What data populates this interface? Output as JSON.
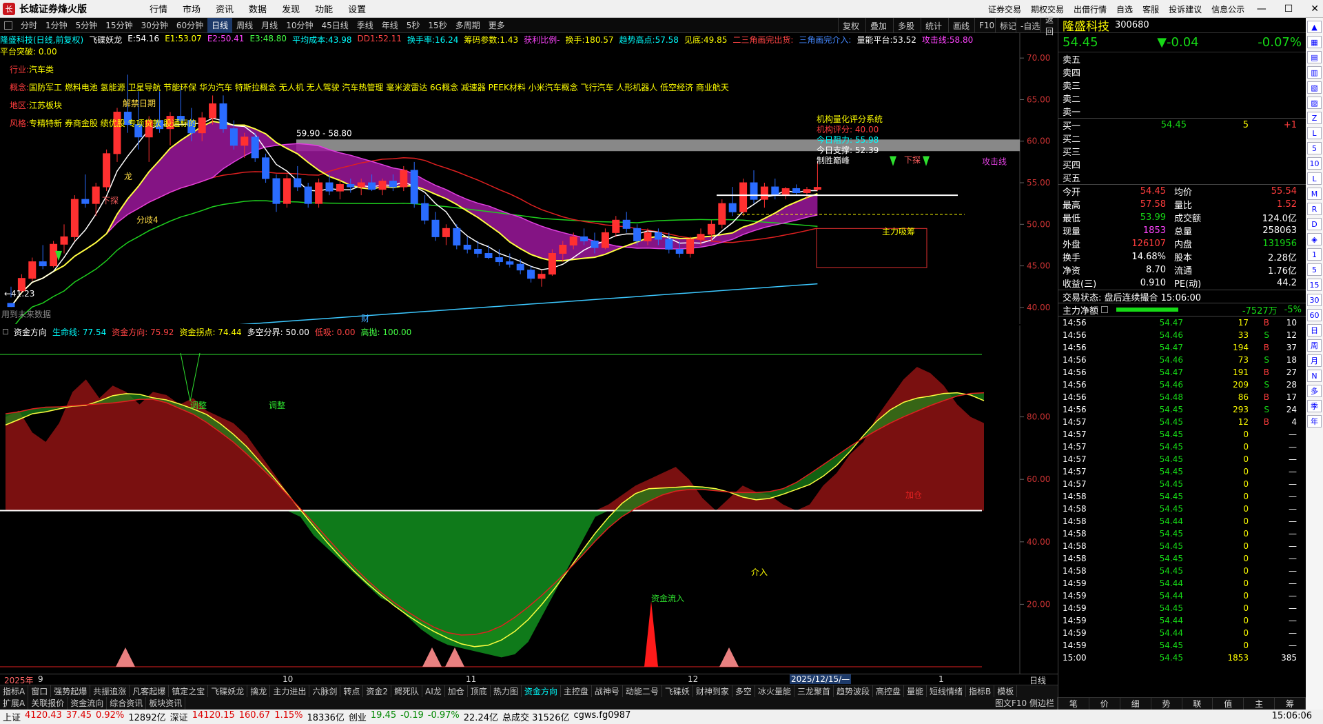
{
  "app": {
    "title": "长城证券烽火版"
  },
  "menu": [
    "行情",
    "市场",
    "资讯",
    "数据",
    "发现",
    "功能",
    "设置"
  ],
  "top_right_menu": [
    "证券交易",
    "期权交易",
    "出借行情",
    "自选",
    "客服",
    "投诉建议",
    "信息公示"
  ],
  "periods": [
    "分时",
    "1分钟",
    "5分钟",
    "15分钟",
    "30分钟",
    "60分钟",
    "日线",
    "周线",
    "月线",
    "10分钟",
    "45日线",
    "季线",
    "年线",
    "5秒",
    "15秒",
    "多周期",
    "更多"
  ],
  "active_period": "日线",
  "toolbar_right": [
    "复权",
    "叠加",
    "多股",
    "统计",
    "画线",
    "F10",
    "标记",
    "-自选",
    "返回"
  ],
  "main_header": {
    "stock": "隆盛科技(日线,前复权)",
    "indicator": "飞碟妖龙",
    "items": [
      {
        "t": "E:54.16",
        "c": "#ffffff"
      },
      {
        "t": "E1:53.07",
        "c": "#ffff00"
      },
      {
        "t": "E2:50.41",
        "c": "#ff44ff"
      },
      {
        "t": "E3:48.80",
        "c": "#44ff44"
      },
      {
        "t": "平均成本:43.98",
        "c": "#00ffff"
      },
      {
        "t": "DD1:52.11",
        "c": "#ff4444"
      },
      {
        "t": "换手率:16.24",
        "c": "#00ffff"
      },
      {
        "t": "筹码参数:1.43",
        "c": "#ffff00"
      },
      {
        "t": "获利比例-",
        "c": "#ff44ff"
      },
      {
        "t": "换手:180.57",
        "c": "#ffff00"
      },
      {
        "t": "趋势高点:57.58",
        "c": "#00ffff"
      },
      {
        "t": "见底:49.85",
        "c": "#ffff00"
      },
      {
        "t": "二三角画完出货:",
        "c": "#ff4444"
      },
      {
        "t": "三角画完介入:",
        "c": "#4488ff"
      },
      {
        "t": "量能平台:53.52",
        "c": "#ffffff"
      },
      {
        "t": "攻击线:58.80",
        "c": "#ff44ff"
      }
    ],
    "platform": "平台突破: 0.00"
  },
  "stock_info": {
    "industry_label": "行业:",
    "industry": "汽车类",
    "concept_label": "概念:",
    "concept": "国防军工 燃料电池 氢能源 卫星导航 节能环保 华为汽车 特斯拉概念 无人机 无人驾驶 汽车热管理 毫米波雷达 6G概念 减速器 PEEK材料 小米汽车概念 飞行汽车 人形机器人 低空经济 商业航天",
    "region_label": "地区:",
    "region": "江苏板块",
    "style_label": "风格:",
    "style": "专精特新 券商金股 绩优股 专项贷款 股通标的"
  },
  "quant_box": {
    "title": "机构量化评分系统",
    "score": "机构评分: 40.00",
    "resist": "今日阻力: 55.98",
    "support": "今日支撑: 52.39",
    "verdict": "制胜巅峰"
  },
  "chart_labels": {
    "range_label": "59.90 - 58.80",
    "low_label": "←41.23",
    "future": "用到未来数据",
    "attack_line": "攻击线",
    "cai": "财",
    "jiejin": "解禁日期",
    "fenyi4": "分歧4",
    "xiatan": "下探",
    "zhuli": "主力吸筹",
    "long": "龙"
  },
  "main_axis": [
    "70.00",
    "65.00",
    "60.00",
    "55.00",
    "50.00",
    "45.00",
    "40.00"
  ],
  "sub_header": {
    "name": "资金方向",
    "items": [
      {
        "t": "生命线: 77.54",
        "c": "#00ffff"
      },
      {
        "t": "资金方向: 75.92",
        "c": "#ff4444"
      },
      {
        "t": "资金拐点: 74.44",
        "c": "#ffff00"
      },
      {
        "t": "多空分界: 50.00",
        "c": "#ffffff"
      },
      {
        "t": "低吸: 0.00",
        "c": "#ff4444"
      },
      {
        "t": "高抛: 100.00",
        "c": "#44ff44"
      }
    ]
  },
  "sub_axis": [
    "80.00",
    "60.00",
    "40.00",
    "20.00"
  ],
  "sub_labels": {
    "tz1": "调整",
    "tz2": "调整",
    "inflow": "资金流入",
    "jieru": "介入",
    "jiaru": "加仓"
  },
  "time_axis": [
    "2025年",
    "9",
    "10",
    "11",
    "12",
    "2025/12/15/—",
    "1"
  ],
  "time_right": "日线",
  "tabs1": [
    "指标A",
    "窗口",
    "强势起爆",
    "共振追涨",
    "凡客起爆",
    "镇定之宝",
    "飞碟妖龙",
    "擒龙",
    "主力进出",
    "六脉剑",
    "转点",
    "资金2",
    "鳄死队",
    "AI龙",
    "加仓",
    "顶底",
    "热力图",
    "资金方向",
    "主控盘",
    "战神号",
    "动能二号",
    "飞碟妖",
    "财神到家",
    "多空",
    "冰火量能",
    "三龙聚首",
    "趋势波段",
    "高控盘",
    "量能",
    "短线情绪",
    "指标B",
    "模板"
  ],
  "tabs1_active": "资金方向",
  "tabs2": [
    "扩展A",
    "关联报价",
    "资金流向",
    "综合资讯",
    "板块资讯"
  ],
  "tabs2_right": "图文F10 侧边栏",
  "quote": {
    "name": "隆盛科技",
    "code": "300680",
    "price": "54.45",
    "change": "▼-0.04",
    "pct": "-0.07%",
    "asks": [
      "卖五",
      "卖四",
      "卖三",
      "卖二",
      "卖一"
    ],
    "bids": [
      {
        "l": "买一",
        "p": "54.45",
        "v": "5",
        "c": "+1"
      },
      {
        "l": "买二",
        "p": "",
        "v": "",
        "c": ""
      },
      {
        "l": "买三",
        "p": "",
        "v": "",
        "c": ""
      },
      {
        "l": "买四",
        "p": "",
        "v": "",
        "c": ""
      },
      {
        "l": "买五",
        "p": "",
        "v": "",
        "c": ""
      }
    ],
    "stats": [
      [
        "今开",
        "54.45",
        "均价",
        "55.54"
      ],
      [
        "最高",
        "57.58",
        "量比",
        "1.52"
      ],
      [
        "最低",
        "53.99",
        "成交额",
        "124.0亿"
      ],
      [
        "现量",
        "1853",
        "总量",
        "258063"
      ],
      [
        "外盘",
        "126107",
        "内盘",
        "131956"
      ],
      [
        "换手",
        "14.68%",
        "股本",
        "2.28亿"
      ],
      [
        "净资",
        "8.70",
        "流通",
        "1.76亿"
      ],
      [
        "收益(三)",
        "0.910",
        "PE(动)",
        "44.2"
      ]
    ],
    "trade_state": "交易状态: 盘后连续撮合 15:06:00",
    "main_net_label": "主力净额",
    "main_net": "-7527万",
    "main_net_pct": "-5%"
  },
  "ticks": [
    [
      "14:56",
      "54.47",
      "17",
      "B",
      "10"
    ],
    [
      "14:56",
      "54.46",
      "33",
      "S",
      "12"
    ],
    [
      "14:56",
      "54.47",
      "194",
      "B",
      "37"
    ],
    [
      "14:56",
      "54.46",
      "73",
      "S",
      "18"
    ],
    [
      "14:56",
      "54.47",
      "191",
      "B",
      "27"
    ],
    [
      "14:56",
      "54.46",
      "209",
      "S",
      "28"
    ],
    [
      "14:56",
      "54.48",
      "86",
      "B",
      "17"
    ],
    [
      "14:56",
      "54.45",
      "293",
      "S",
      "24"
    ],
    [
      "14:57",
      "54.45",
      "12",
      "B",
      "4"
    ],
    [
      "14:57",
      "54.45",
      "0",
      "",
      ""
    ],
    [
      "14:57",
      "54.45",
      "0",
      "",
      ""
    ],
    [
      "14:57",
      "54.45",
      "0",
      "",
      ""
    ],
    [
      "14:57",
      "54.45",
      "0",
      "",
      ""
    ],
    [
      "14:57",
      "54.45",
      "0",
      "",
      ""
    ],
    [
      "14:58",
      "54.45",
      "0",
      "",
      ""
    ],
    [
      "14:58",
      "54.45",
      "0",
      "",
      ""
    ],
    [
      "14:58",
      "54.44",
      "0",
      "",
      ""
    ],
    [
      "14:58",
      "54.45",
      "0",
      "",
      ""
    ],
    [
      "14:58",
      "54.45",
      "0",
      "",
      ""
    ],
    [
      "14:58",
      "54.45",
      "0",
      "",
      ""
    ],
    [
      "14:58",
      "54.45",
      "0",
      "",
      ""
    ],
    [
      "14:59",
      "54.44",
      "0",
      "",
      ""
    ],
    [
      "14:59",
      "54.44",
      "0",
      "",
      ""
    ],
    [
      "14:59",
      "54.45",
      "0",
      "",
      ""
    ],
    [
      "14:59",
      "54.44",
      "0",
      "",
      ""
    ],
    [
      "14:59",
      "54.44",
      "0",
      "",
      ""
    ],
    [
      "14:59",
      "54.45",
      "0",
      "",
      ""
    ],
    [
      "15:00",
      "54.45",
      "1853",
      "",
      "385"
    ]
  ],
  "rp_tabs": [
    "笔",
    "价",
    "细",
    "势",
    "联",
    "值",
    "主",
    "筹"
  ],
  "sidebar": [
    "▲",
    "▦",
    "▤",
    "▥",
    "▧",
    "▨",
    "Z",
    "L",
    "5",
    "10",
    "L",
    "M",
    "R",
    "D",
    "◈",
    "1",
    "5",
    "15",
    "30",
    "60",
    "日",
    "周",
    "月",
    "N",
    "多",
    "季",
    "年"
  ],
  "statusbar": [
    {
      "t": "上证",
      "c": ""
    },
    {
      "t": "4120.43",
      "c": "up"
    },
    {
      "t": "37.45",
      "c": "up"
    },
    {
      "t": "0.92%",
      "c": "up"
    },
    {
      "t": "12892亿",
      "c": ""
    },
    {
      "t": "深证",
      "c": ""
    },
    {
      "t": "14120.15",
      "c": "up"
    },
    {
      "t": "160.67",
      "c": "up"
    },
    {
      "t": "1.15%",
      "c": "up"
    },
    {
      "t": "18336亿",
      "c": ""
    },
    {
      "t": "创业",
      "c": ""
    },
    {
      "t": "19.45",
      "c": "dn"
    },
    {
      "t": "-0.19",
      "c": "dn"
    },
    {
      "t": "-0.97%",
      "c": "dn"
    },
    {
      "t": "22.24亿",
      "c": ""
    },
    {
      "t": "总成交 31526亿",
      "c": ""
    },
    {
      "t": "cgws.fg0987",
      "c": ""
    }
  ],
  "clock": "15:06:06",
  "chart_data": {
    "type": "candlestick",
    "candles": [
      [
        40.5,
        42.5,
        41.2,
        40.1
      ],
      [
        42.0,
        44.0,
        41.8,
        43.5
      ],
      [
        43.5,
        46.0,
        43.2,
        45.5
      ],
      [
        45.5,
        47.5,
        44.6,
        45.0
      ],
      [
        45.0,
        48.0,
        44.8,
        47.6
      ],
      [
        47.6,
        50.0,
        46.5,
        48.5
      ],
      [
        48.5,
        53.5,
        48.0,
        53.0
      ],
      [
        53.0,
        56.0,
        52.0,
        52.5
      ],
      [
        52.5,
        55.0,
        51.0,
        54.5
      ],
      [
        54.5,
        59.0,
        54.0,
        58.5
      ],
      [
        58.5,
        64.0,
        57.5,
        63.5
      ],
      [
        63.5,
        68.0,
        61.0,
        62.0
      ],
      [
        62.0,
        66.0,
        59.0,
        60.5
      ],
      [
        60.5,
        63.0,
        57.5,
        62.5
      ],
      [
        62.5,
        66.0,
        61.0,
        61.5
      ],
      [
        61.5,
        63.5,
        59.5,
        63.0
      ],
      [
        63.0,
        66.5,
        62.0,
        62.5
      ],
      [
        62.5,
        64.0,
        60.0,
        61.0
      ],
      [
        61.0,
        63.5,
        60.0,
        62.8
      ],
      [
        62.8,
        65.5,
        62.0,
        64.5
      ],
      [
        64.5,
        65.5,
        61.0,
        61.5
      ],
      [
        61.5,
        62.5,
        59.0,
        59.5
      ],
      [
        59.5,
        61.0,
        58.0,
        60.5
      ],
      [
        60.5,
        61.0,
        57.5,
        58.0
      ],
      [
        58.0,
        58.5,
        55.0,
        55.5
      ],
      [
        55.5,
        56.0,
        51.5,
        52.5
      ],
      [
        52.5,
        56.0,
        52.0,
        55.5
      ],
      [
        55.5,
        57.0,
        54.0,
        54.5
      ],
      [
        54.5,
        55.0,
        52.0,
        52.5
      ],
      [
        52.5,
        55.5,
        52.0,
        55.0
      ],
      [
        55.0,
        56.0,
        53.5,
        54.0
      ],
      [
        54.0,
        55.5,
        53.0,
        54.8
      ],
      [
        54.8,
        55.5,
        53.8,
        54.5
      ],
      [
        54.5,
        55.5,
        53.5,
        55.0
      ],
      [
        55.0,
        56.0,
        54.0,
        54.2
      ],
      [
        54.2,
        55.5,
        53.5,
        55.2
      ],
      [
        55.2,
        56.0,
        54.0,
        54.5
      ],
      [
        54.5,
        57.0,
        54.0,
        56.5
      ],
      [
        56.5,
        57.5,
        52.0,
        52.5
      ],
      [
        52.5,
        53.5,
        50.0,
        50.5
      ],
      [
        50.5,
        51.5,
        48.0,
        48.5
      ],
      [
        48.5,
        50.0,
        47.5,
        49.5
      ],
      [
        49.5,
        50.0,
        47.0,
        47.5
      ],
      [
        47.5,
        48.5,
        46.5,
        47.0
      ],
      [
        47.0,
        48.0,
        46.0,
        46.5
      ],
      [
        46.5,
        47.5,
        45.8,
        46.0
      ],
      [
        46.0,
        47.0,
        45.0,
        45.5
      ],
      [
        45.5,
        46.5,
        44.8,
        45.2
      ],
      [
        45.2,
        45.8,
        44.0,
        44.5
      ],
      [
        44.5,
        45.0,
        43.0,
        43.5
      ],
      [
        43.5,
        44.5,
        42.5,
        44.0
      ],
      [
        44.0,
        47.0,
        43.8,
        46.5
      ],
      [
        46.5,
        48.0,
        45.5,
        47.5
      ],
      [
        47.5,
        49.0,
        47.0,
        48.5
      ],
      [
        48.5,
        49.5,
        47.5,
        48.0
      ],
      [
        48.0,
        49.0,
        46.5,
        47.2
      ],
      [
        47.2,
        49.5,
        47.0,
        49.0
      ],
      [
        49.0,
        51.0,
        48.5,
        50.5
      ],
      [
        50.5,
        51.5,
        49.0,
        49.5
      ],
      [
        49.5,
        50.0,
        47.5,
        48.0
      ],
      [
        48.0,
        49.5,
        47.5,
        49.0
      ],
      [
        49.0,
        49.5,
        47.5,
        48.2
      ],
      [
        48.2,
        49.0,
        46.5,
        47.0
      ],
      [
        47.0,
        48.0,
        46.0,
        46.5
      ],
      [
        46.5,
        48.5,
        46.0,
        48.2
      ],
      [
        48.2,
        49.5,
        47.5,
        48.8
      ],
      [
        48.8,
        50.5,
        48.0,
        50.0
      ],
      [
        50.0,
        53.0,
        49.5,
        52.5
      ],
      [
        52.5,
        54.5,
        51.0,
        51.5
      ],
      [
        51.5,
        55.5,
        51.0,
        55.0
      ],
      [
        55.0,
        56.5,
        52.5,
        53.0
      ],
      [
        53.0,
        55.0,
        52.0,
        54.5
      ],
      [
        54.5,
        55.5,
        53.0,
        53.5
      ],
      [
        53.5,
        54.5,
        53.0,
        54.3
      ],
      [
        54.3,
        54.8,
        53.5,
        53.8
      ],
      [
        53.8,
        54.5,
        53.0,
        54.2
      ],
      [
        54.2,
        57.6,
        54.0,
        54.45
      ]
    ],
    "subchart": {
      "name": "资金方向",
      "life_line": 77.54,
      "direction": 75.92,
      "turn": 74.44,
      "divide": 50.0,
      "low": 0.0,
      "high": 100.0
    }
  }
}
